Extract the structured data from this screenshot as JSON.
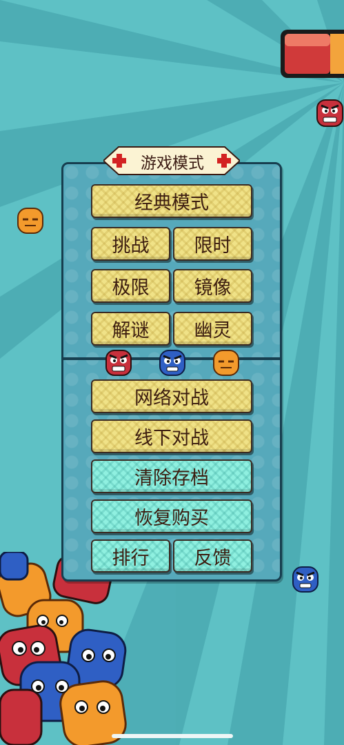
{
  "menu": {
    "title": "游戏模式",
    "classic_label": "经典模式",
    "challenge_label": "挑战",
    "time_limit_label": "限时",
    "extreme_label": "极限",
    "mirror_label": "镜像",
    "puzzle_label": "解谜",
    "ghost_label": "幽灵",
    "online_battle_label": "网络对战",
    "offline_battle_label": "线下对战",
    "clear_save_label": "清除存档",
    "restore_purchase_label": "恢复购买",
    "ranking_label": "排行",
    "feedback_label": "反馈"
  },
  "colors": {
    "background": "#5ec1c5",
    "panel": "#56a9bb",
    "yellow_button": "#f0e287",
    "cyan_button": "#8ff0e0",
    "blob_red": "#c8303c",
    "blob_blue": "#2f5fc4",
    "blob_orange": "#f39a2c"
  },
  "icons": {
    "title_badge": "red-cross-icon",
    "characters": [
      "red-blob-angry",
      "blue-blob-angry",
      "orange-blob-sleepy"
    ]
  }
}
